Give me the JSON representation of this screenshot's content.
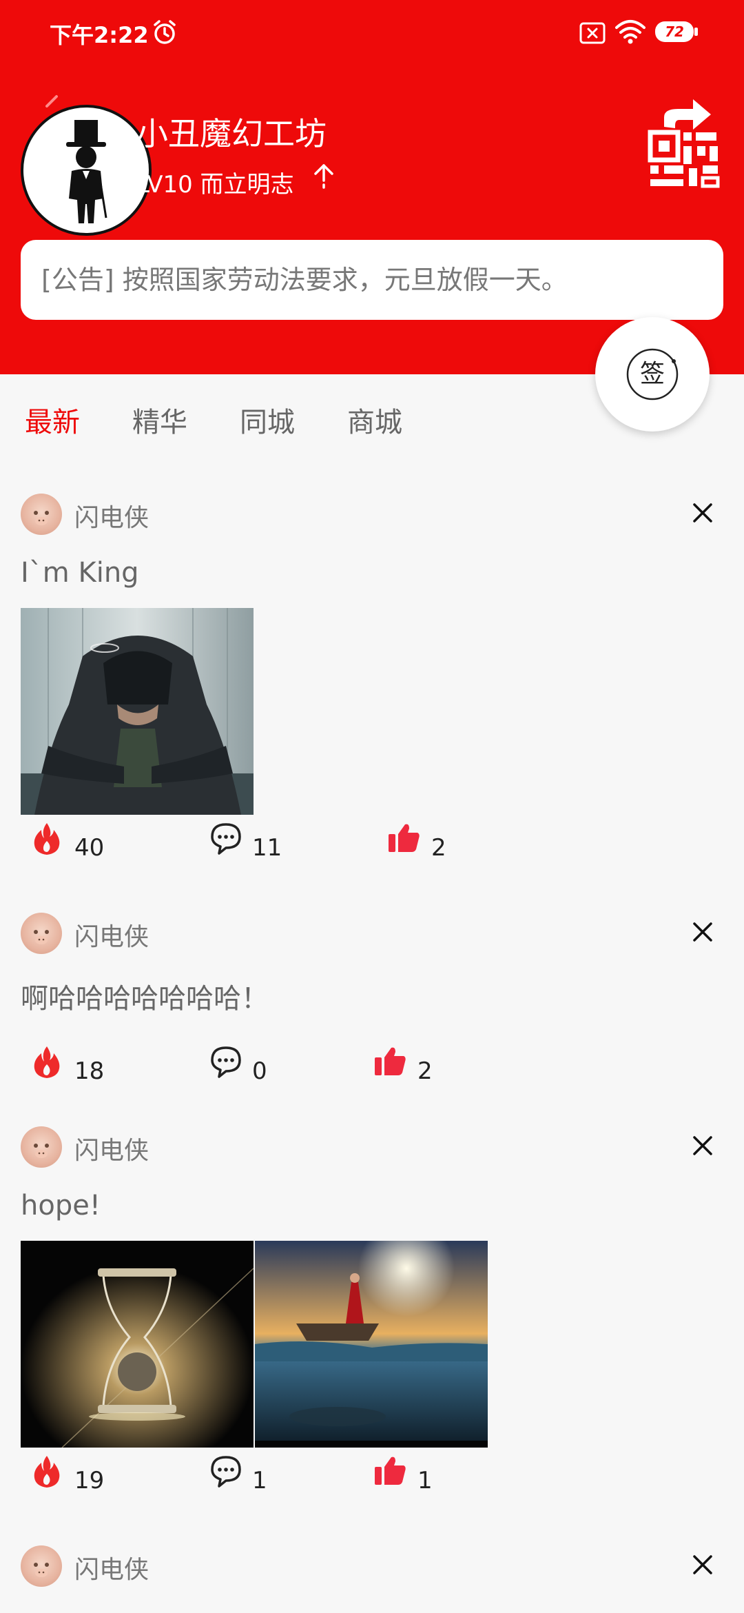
{
  "status_bar": {
    "time": "下午2:22",
    "battery": "72"
  },
  "header": {
    "group_name": "小丑魔幻工坊",
    "group_level": "LV10 而立明志",
    "notice": "[公告] 按照国家劳动法要求，元旦放假一天。",
    "sign_label": "签",
    "colors": {
      "accent": "#ee0a0a"
    }
  },
  "tabs": [
    {
      "label": "最新",
      "active": true
    },
    {
      "label": "精华",
      "active": false
    },
    {
      "label": "同城",
      "active": false
    },
    {
      "label": "商城",
      "active": false
    }
  ],
  "posts": [
    {
      "author": "闪电侠",
      "text": "I`m King",
      "images": [
        "hooded-man-photo"
      ],
      "hot": "40",
      "comments": "11",
      "likes": "2"
    },
    {
      "author": "闪电侠",
      "text": "啊哈哈哈哈哈哈哈！",
      "images": [],
      "hot": "18",
      "comments": "0",
      "likes": "2"
    },
    {
      "author": "闪电侠",
      "text": "hope!",
      "images": [
        "hourglass-photo",
        "boat-at-sea-photo"
      ],
      "hot": "19",
      "comments": "1",
      "likes": "1"
    },
    {
      "author": "闪电侠"
    }
  ]
}
